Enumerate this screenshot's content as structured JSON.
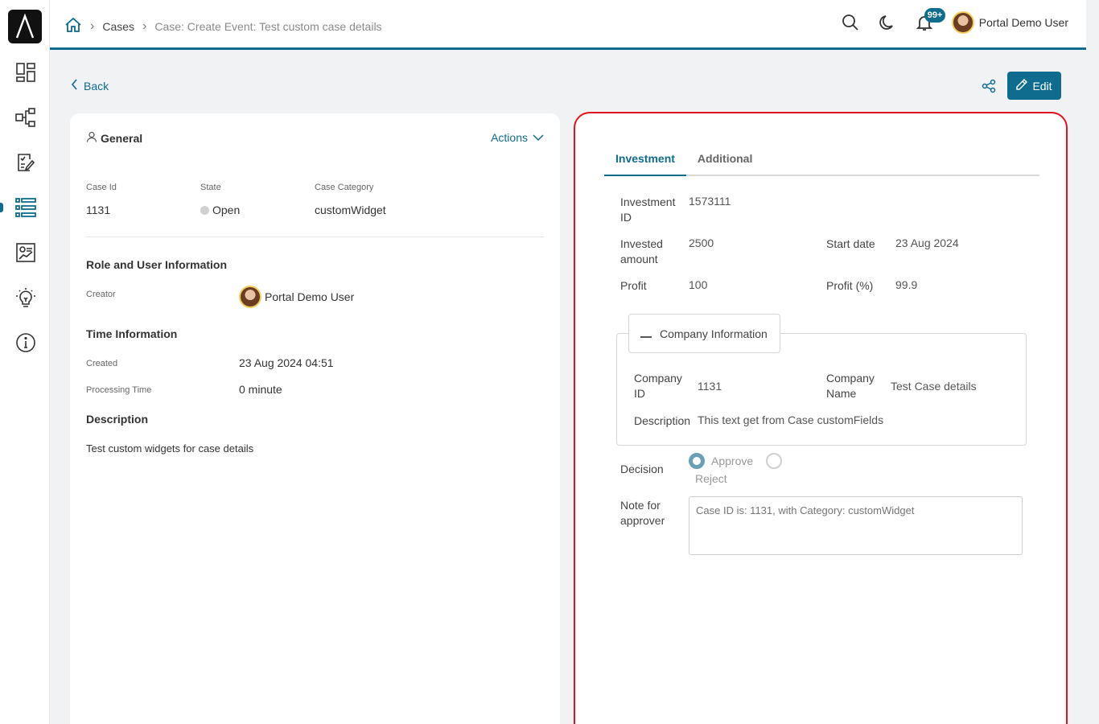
{
  "breadcrumb": {
    "items": [
      "Cases",
      "Case: Create Event: Test custom case details"
    ]
  },
  "header": {
    "notification_count": "99+",
    "user_name": "Portal Demo User"
  },
  "toolbar": {
    "back_label": "Back",
    "edit_label": "Edit"
  },
  "general": {
    "title": "General",
    "actions_label": "Actions",
    "fields": {
      "case_id_label": "Case Id",
      "case_id": "1131",
      "state_label": "State",
      "state": "Open",
      "category_label": "Case Category",
      "category": "customWidget"
    },
    "role_section": "Role and User Information",
    "creator_label": "Creator",
    "creator": "Portal Demo User",
    "time_section": "Time Information",
    "created_label": "Created",
    "created": "23 Aug 2024 04:51",
    "processing_label": "Processing Time",
    "processing": "0 minute",
    "description_section": "Description",
    "description": "Test custom widgets for case details"
  },
  "investment": {
    "tabs": [
      "Investment",
      "Additional"
    ],
    "investment_id_label": "Investment ID",
    "investment_id": "1573111",
    "invested_amount_label": "Invested amount",
    "invested_amount": "2500",
    "start_date_label": "Start date",
    "start_date": "23 Aug 2024",
    "profit_label": "Profit",
    "profit": "100",
    "profit_pct_label": "Profit (%)",
    "profit_pct": "99.9",
    "company_panel_title": "Company Information",
    "company_id_label": "Company ID",
    "company_id": "1131",
    "company_name_label": "Company Name",
    "company_name": "Test Case details",
    "company_desc_label": "Description",
    "company_desc": "This text get from Case customFields",
    "decision_label": "Decision",
    "decision_options": [
      "Approve",
      "Reject"
    ],
    "note_label": "Note for approver",
    "note_placeholder": "Case ID is: 1131, with Category: customWidget"
  },
  "colors": {
    "accent": "#0f6c8e",
    "highlight_border": "#e0141e"
  }
}
